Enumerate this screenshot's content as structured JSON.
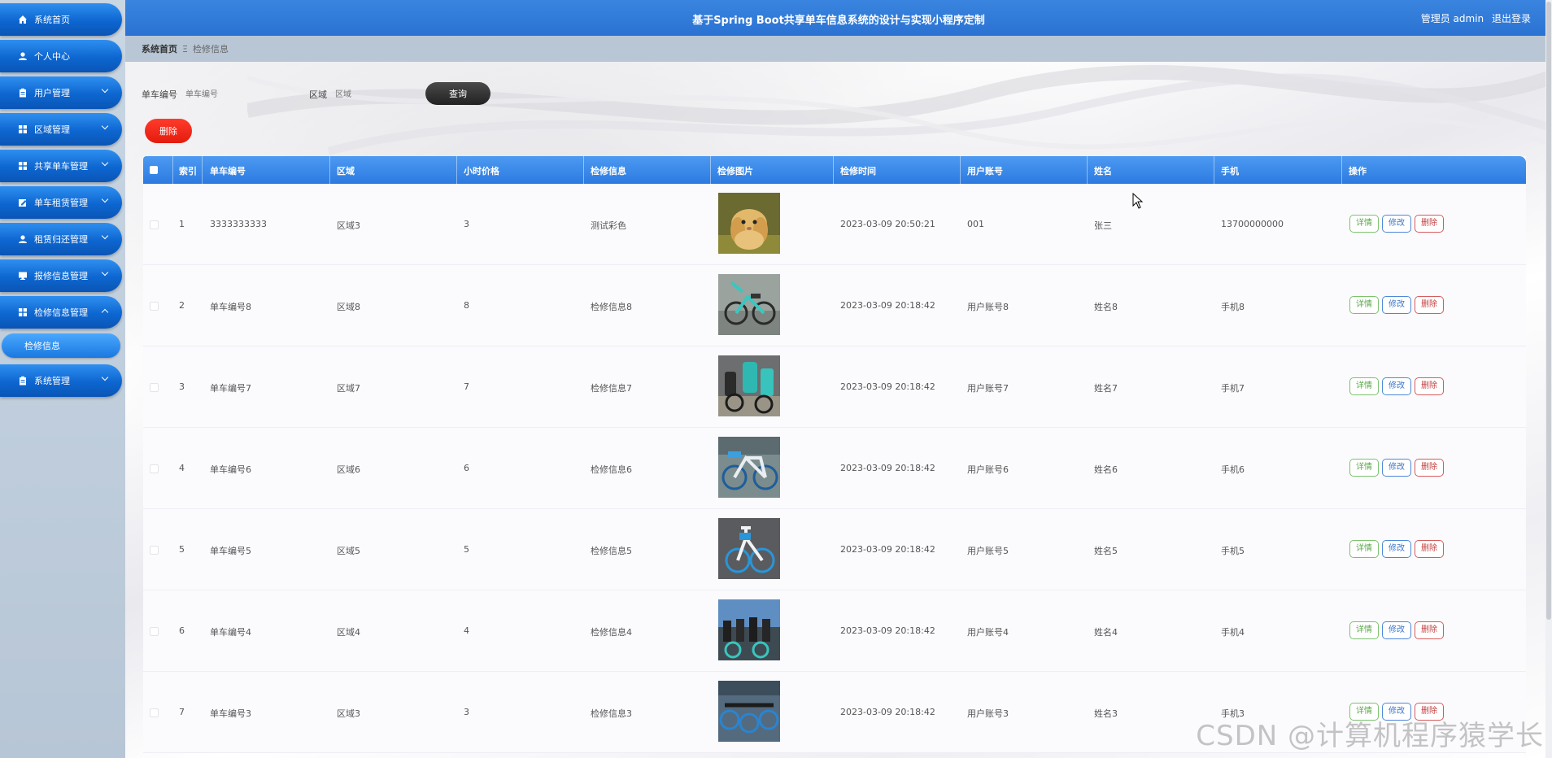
{
  "header": {
    "title": "基于Spring Boot共享单车信息系统的设计与实现小程序定制",
    "user": "管理员 admin",
    "logout": "退出登录"
  },
  "sidebar": {
    "items": [
      {
        "label": "系统首页",
        "icon": "home-icon"
      },
      {
        "label": "个人中心",
        "icon": "user-icon"
      },
      {
        "label": "用户管理",
        "icon": "clipboard-icon"
      },
      {
        "label": "区域管理",
        "icon": "grid-icon"
      },
      {
        "label": "共享单车管理",
        "icon": "grid-icon"
      },
      {
        "label": "单车租赁管理",
        "icon": "edit-icon"
      },
      {
        "label": "租赁归还管理",
        "icon": "user-icon"
      },
      {
        "label": "报修信息管理",
        "icon": "monitor-icon"
      },
      {
        "label": "检修信息管理",
        "icon": "grid-icon"
      },
      {
        "label": "系统管理",
        "icon": "clipboard-icon"
      }
    ],
    "sub_item": "检修信息"
  },
  "breadcrumb": {
    "home": "系统首页",
    "separator": "Ξ",
    "current": "检修信息"
  },
  "search": {
    "bike_label": "单车编号",
    "bike_placeholder": "单车编号",
    "area_label": "区域",
    "area_placeholder": "区域",
    "query_button": "查询"
  },
  "toolbar": {
    "delete_button": "删除"
  },
  "table": {
    "columns": [
      "索引",
      "单车编号",
      "区域",
      "小时价格",
      "检修信息",
      "检修图片",
      "检修时间",
      "用户账号",
      "姓名",
      "手机",
      "操作"
    ],
    "rows": [
      {
        "index": "1",
        "bike": "3333333333",
        "area": "区域3",
        "price": "3",
        "info": "测试彩色",
        "time": "2023-03-09 20:50:21",
        "account": "001",
        "name": "张三",
        "phone": "13700000000",
        "pic": "rabbit"
      },
      {
        "index": "2",
        "bike": "单车编号8",
        "area": "区域8",
        "price": "8",
        "info": "检修信息8",
        "time": "2023-03-09 20:18:42",
        "account": "用户账号8",
        "name": "姓名8",
        "phone": "手机8",
        "pic": "bike-teal"
      },
      {
        "index": "3",
        "bike": "单车编号7",
        "area": "区域7",
        "price": "7",
        "info": "检修信息7",
        "time": "2023-03-09 20:18:42",
        "account": "用户账号7",
        "name": "姓名7",
        "phone": "手机7",
        "pic": "bike-row"
      },
      {
        "index": "4",
        "bike": "单车编号6",
        "area": "区域6",
        "price": "6",
        "info": "检修信息6",
        "time": "2023-03-09 20:18:42",
        "account": "用户账号6",
        "name": "姓名6",
        "phone": "手机6",
        "pic": "bike-blue"
      },
      {
        "index": "5",
        "bike": "单车编号5",
        "area": "区域5",
        "price": "5",
        "info": "检修信息5",
        "time": "2023-03-09 20:18:42",
        "account": "用户账号5",
        "name": "姓名5",
        "phone": "手机5",
        "pic": "bike-white"
      },
      {
        "index": "6",
        "bike": "单车编号4",
        "area": "区域4",
        "price": "4",
        "info": "检修信息4",
        "time": "2023-03-09 20:18:42",
        "account": "用户账号4",
        "name": "姓名4",
        "phone": "手机4",
        "pic": "bike-street"
      },
      {
        "index": "7",
        "bike": "单车编号3",
        "area": "区域3",
        "price": "3",
        "info": "检修信息3",
        "time": "2023-03-09 20:18:42",
        "account": "用户账号3",
        "name": "姓名3",
        "phone": "手机3",
        "pic": "bike-parked"
      }
    ],
    "actions": {
      "detail": "详情",
      "edit": "修改",
      "delete": "删除"
    }
  },
  "watermark": "CSDN @计算机程序猿学长",
  "colors": {
    "header": "#2f78d8",
    "sidebar_button": "#0d66d0",
    "delete": "#e31b0e",
    "query": "#2b2b2b"
  }
}
